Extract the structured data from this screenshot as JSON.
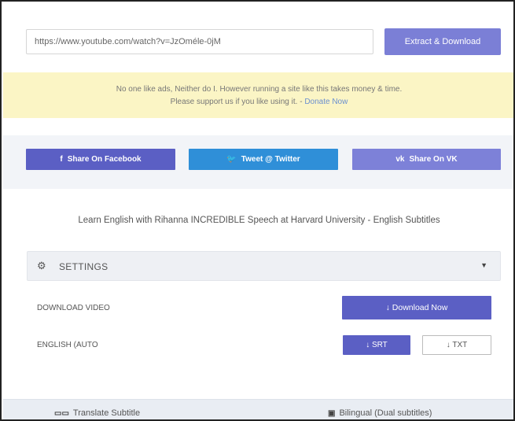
{
  "url_input": {
    "value": "https://www.youtube.com/watch?v=JzOméle-0jM",
    "extract_label": "Extract & Download"
  },
  "notice": {
    "line1": "No one like ads, Neither do I. However running a site like this takes money & time.",
    "line2": "Please support us if you like using it.",
    "separator": " - ",
    "donate_link": "Donate Now"
  },
  "share": {
    "facebook_icon": "f",
    "facebook_label": "Share On Facebook",
    "twitter_icon": "🐦",
    "twitter_label": "Tweet @ Twitter",
    "vk_icon": "vk",
    "vk_label": "Share On VK"
  },
  "video": {
    "title": "Learn English with Rihanna INCREDIBLE Speech at Harvard University - English Subtitles"
  },
  "settings": {
    "label": "SETTINGS"
  },
  "download": {
    "video_label": "DOWNLOAD VIDEO",
    "video_button": "Download Now",
    "subtitle_label": "ENGLISH (AUTO",
    "srt_button": "SRT",
    "txt_button": "TXT"
  },
  "bottom": {
    "translate_label": "Translate Subtitle",
    "bilingual_label": "Bilingual (Dual subtitles)"
  },
  "colors": {
    "primary": "#5b5fc4",
    "twitter": "#2f8fd8",
    "notice_bg": "#fbf5c5",
    "link": "#6a8fd0"
  }
}
